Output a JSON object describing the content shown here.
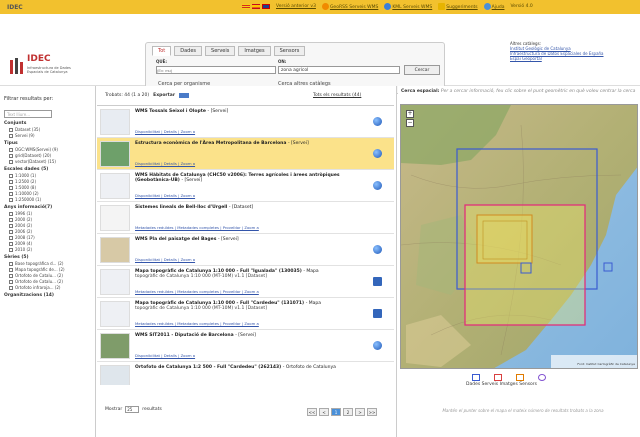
{
  "topbar": {
    "logo": "IDEC",
    "links": [
      {
        "label": "Versió anterior v3",
        "icon": "arrow-icon"
      },
      {
        "label": "GeoRSS Serveis WMS",
        "icon": "rss-icon"
      },
      {
        "label": "KML Serveis WMS",
        "icon": "kml-icon"
      },
      {
        "label": "Suggeriments",
        "icon": "mail-icon"
      },
      {
        "label": "Ajuda",
        "icon": "help-icon"
      }
    ],
    "version": "Versió 4.0",
    "accent": "#f2c12e"
  },
  "header": {
    "org_name": "IDEC",
    "org_subtitle": "Infraestructura de Dades Espacials de Catalunya",
    "tabs": [
      "Tot",
      "Dades",
      "Serveis",
      "Imatges",
      "Sensors"
    ],
    "active_tab": "Tot",
    "que_label": "QUÈ:",
    "que_placeholder": "(Ex: mu)",
    "on_label": "ON:",
    "on_value": "zona agrícol",
    "search_button": "Cercar",
    "by_org_link": "Cerca per organisme",
    "other_catalogs_link": "Cerca altres catàlegs",
    "other_catalogs_title": "Altres catàlegs:",
    "other_catalogs": [
      "Institut Geològic de Catalunya",
      "Infraestructura de Datos Espaciales de España",
      "Espai Geoportal"
    ]
  },
  "filters": {
    "title": "Filtrar resultats per:",
    "free_text_placeholder": "Text lliure...",
    "groups": [
      {
        "label": "Conjunts",
        "items": [
          "Dataset (35)",
          "Servei (9)"
        ]
      },
      {
        "label": "Tipus",
        "items": [
          "OGC:WMS(Servei) (9)",
          "grid(Dataset) (20)",
          "vector(Dataset) (15)"
        ]
      },
      {
        "label": "Escales dades (5)",
        "items": [
          "1:1000 (1)",
          "1:2500 (2)",
          "1:5000 (8)",
          "1:10000 (2)",
          "1:250000 (1)"
        ]
      },
      {
        "label": "Anys informació(7)",
        "items": [
          "1996 (1)",
          "2000 (2)",
          "2004 (2)",
          "2006 (2)",
          "2008 (17)",
          "2009 (4)",
          "2010 (2)"
        ]
      },
      {
        "label": "Sèries (5)",
        "items": [
          "Base topogràfica d... (2)",
          "Mapa topogràfic de... (2)",
          "Ortofoto de Catalu... (2)",
          "Ortofoto de Catalu... (2)",
          "Ortofoto infraroja... (2)"
        ]
      },
      {
        "label": "Organitzacions (14)",
        "items": []
      }
    ]
  },
  "results": {
    "summary": "Trobats: 44 (1 a 20)",
    "export_label": "Exportar",
    "see_all_link": "Tots els resultats (44)",
    "items": [
      {
        "title": "WMS Tossals Seixol i Olopte",
        "type": "- [Servei]",
        "subtitle": "",
        "links": "Disponibilitat | Detalls | Zoom a",
        "icon": "globe-icon",
        "highlight": false
      },
      {
        "title": "Estructura econòmica de l'Àrea Metropolitana de Barcelona",
        "type": "- [Servei]",
        "subtitle": "",
        "links": "Disponibilitat | Detalls | Zoom a",
        "icon": "globe-icon",
        "highlight": true
      },
      {
        "title": "WMS Hàbitats de Catalunya (CHC50 v2006): Terres agrícoles i àrees antròpiques (Geobotànica-UB)",
        "type": "- [Servei]",
        "subtitle": "",
        "links": "Disponibilitat | Detalls | Zoom a",
        "icon": "globe-icon",
        "highlight": false
      },
      {
        "title": "Sistemes lineals de Bell-lloc d'Urgell",
        "type": "- [Dataset]",
        "subtitle": "",
        "links": "Metadades reduïdes | Metadades completes | Proveïdor | Zoom a",
        "icon": "",
        "highlight": false
      },
      {
        "title": "WMS Pla del paisatge del Bages",
        "type": "- [Servei]",
        "subtitle": "",
        "links": "Disponibilitat | Detalls | Zoom a",
        "icon": "globe-icon",
        "highlight": false
      },
      {
        "title": "Mapa topogràfic de Catalunya 1:10 000 - Full \"Igualada\" (130035)",
        "type": "- Mapa",
        "subtitle": "topogràfic de Catalunya 1:10 000 (MT-10M) v1.1 [Dataset]",
        "links": "Metadades reduïdes | Metadades completes | Proveïdor | Zoom a",
        "icon": "info-icon",
        "highlight": false
      },
      {
        "title": "Mapa topogràfic de Catalunya 1:10 000 - Full \"Cardedeu\" (131071)",
        "type": "- Mapa",
        "subtitle": "topogràfic de Catalunya 1:10 000 (MT-10M) v1.1 [Dataset]",
        "links": "Metadades reduïdes | Metadades completes | Proveïdor | Zoom a",
        "icon": "info-icon",
        "highlight": false
      },
      {
        "title": "WMS SIT2011 - Diputació de Barcelona",
        "type": "- [Servei]",
        "subtitle": "",
        "links": "Disponibilitat | Detalls | Zoom a",
        "icon": "globe-icon",
        "highlight": false
      },
      {
        "title": "Ortofoto de Catalunya 1:2 500 - Full \"Cardedeu\" (262143)",
        "type": "- Ortofoto de Catalunya",
        "subtitle": "",
        "links": "",
        "icon": "",
        "highlight": false
      }
    ],
    "show_label": "Mostrar",
    "show_value": "25",
    "results_label": "resultats",
    "pager": [
      "<<",
      "<",
      "1",
      "2",
      ">",
      ">>"
    ],
    "active_page": "1"
  },
  "map": {
    "title_bold": "Cerca espacial:",
    "title_hint": "Per a cercar informació, feu clic sobre el punt geomètric en què voleu centrar la cerca",
    "legend": [
      {
        "label": "Dades",
        "color": "#3a5bd1"
      },
      {
        "label": "Serveis",
        "color": "#d94040"
      },
      {
        "label": "Imatges",
        "color": "#e07b00"
      },
      {
        "label": "Sensors",
        "color": "#8050d0"
      }
    ],
    "attribution": "Font: Institut Cartogràfic de Catalunya",
    "hint": "Mantén el punter sobre el mapa el mateix número de resultats trobats a la zona"
  }
}
